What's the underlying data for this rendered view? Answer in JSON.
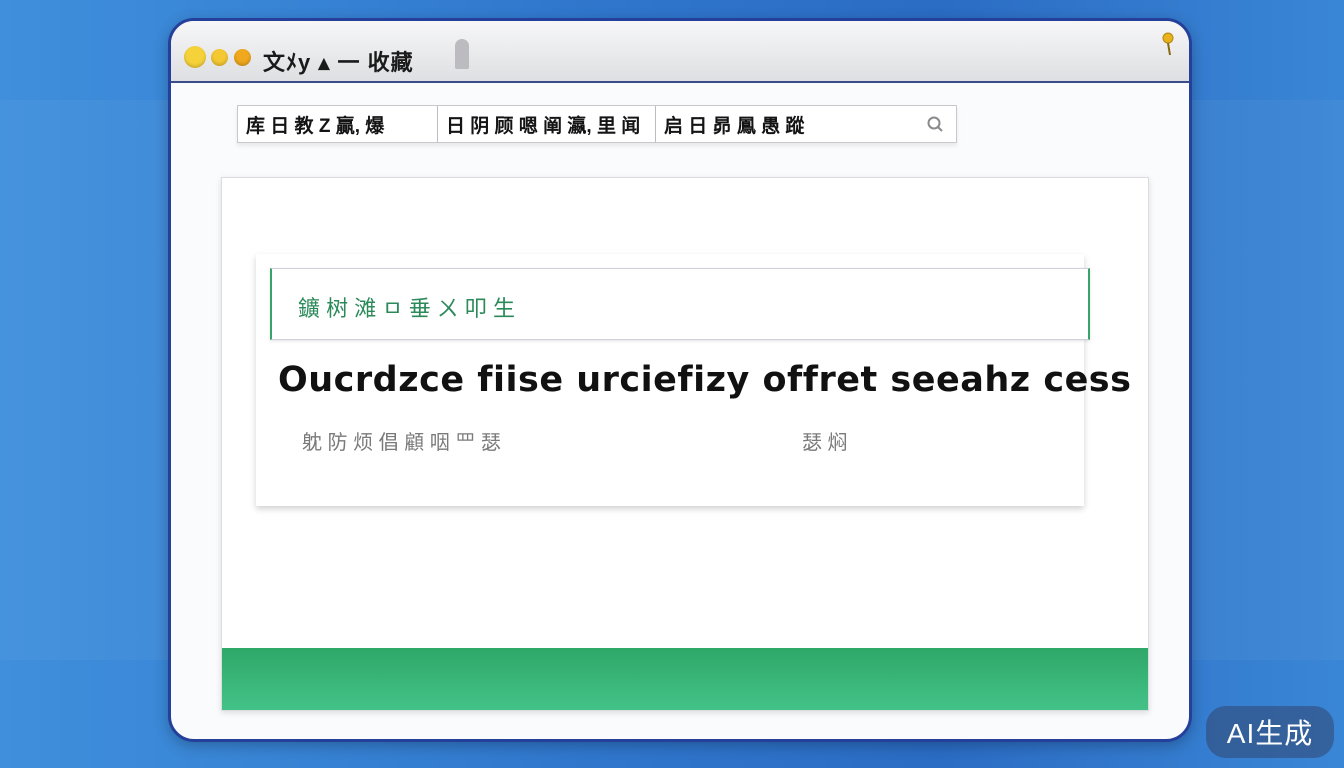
{
  "window": {
    "title": "文ﾒy ▴ 一 收藏"
  },
  "toolbar": {
    "fields": [
      {
        "label": "库 日 教 Z 贏, 爆"
      },
      {
        "label": "日 阴 顾 嗯 阐 瀛, 里 闻"
      },
      {
        "label": "启 日 昴 鳳 愚 蹤"
      }
    ]
  },
  "main": {
    "search_text": "鑛 树 滩 ㅁ 垂 ㄨ 叩 生",
    "headline": "Oucrdzce fiise urciefizy offret  seeahz cess",
    "subtext_left": "躭 防 烦 倡 顧 咽 罒 瑟",
    "subtext_right": "瑟 焖"
  },
  "badge": {
    "label": "AI生成"
  },
  "colors": {
    "desktop": "#2f76cc",
    "window_border": "#24409a",
    "accent_green": "#2fa868",
    "close_dot": "#f6d23a",
    "minimize_dot": "#f4c832",
    "zoom_dot": "#f0a81e"
  }
}
